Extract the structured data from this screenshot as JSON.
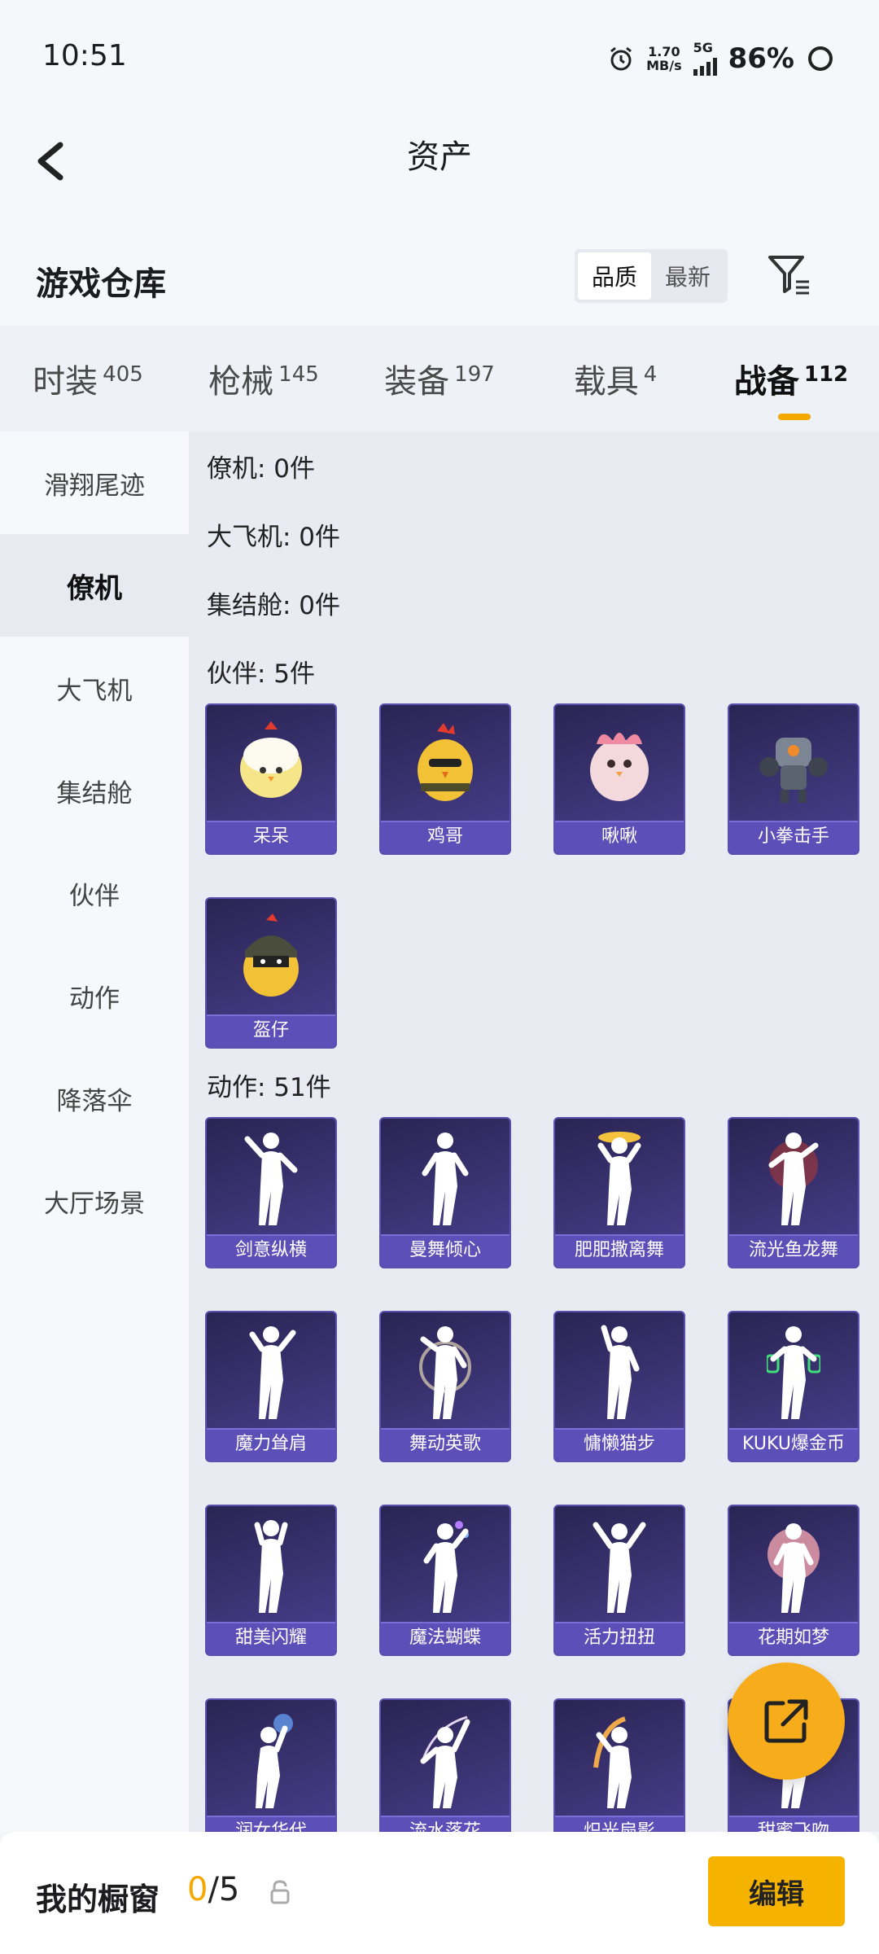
{
  "status_bar": {
    "time": "10:51",
    "speed_value": "1.70",
    "speed_unit": "MB/s",
    "network": "5G",
    "battery": "86%"
  },
  "header": {
    "title": "资产"
  },
  "warehouse": {
    "title": "游戏仓库",
    "sort_quality": "品质",
    "sort_newest": "最新"
  },
  "tabs": [
    {
      "label": "时装",
      "count": "405"
    },
    {
      "label": "枪械",
      "count": "145"
    },
    {
      "label": "装备",
      "count": "197"
    },
    {
      "label": "载具",
      "count": "4"
    },
    {
      "label": "战备",
      "count": "112"
    }
  ],
  "sidebar": [
    "滑翔尾迹",
    "僚机",
    "大飞机",
    "集结舱",
    "伙伴",
    "动作",
    "降落伞",
    "大厅场景"
  ],
  "groups": {
    "wingman": "僚机: 0件",
    "big_plane": "大飞机: 0件",
    "pod": "集结舱: 0件",
    "partner": "伙伴: 5件",
    "emote": "动作: 51件"
  },
  "partners": [
    "呆呆",
    "鸡哥",
    "啾啾",
    "小拳击手",
    "盔仔"
  ],
  "emotes": [
    "剑意纵横",
    "曼舞倾心",
    "肥肥撒离舞",
    "流光鱼龙舞",
    "魔力耸肩",
    "舞动英歌",
    "慵懒猫步",
    "KUKU爆金币",
    "甜美闪耀",
    "魔法蝴蝶",
    "活力扭扭",
    "花期如梦",
    "润女华代",
    "流水落花",
    "炽光扇影",
    "甜蜜飞吻"
  ],
  "colors": {
    "accent": "#f5a800",
    "card_bg": "#3b3474",
    "card_label": "#5d4fb8"
  },
  "bottom": {
    "title": "我的橱窗",
    "count_current": "0",
    "count_total": "/5",
    "edit": "编辑"
  }
}
